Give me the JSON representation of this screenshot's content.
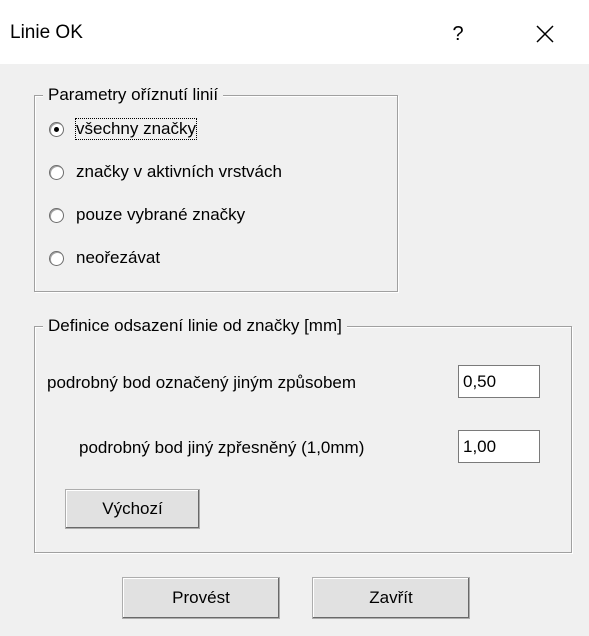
{
  "window": {
    "title": "Linie OK",
    "help_label": "?",
    "close_icon": "close-icon"
  },
  "clip_group": {
    "legend": "Parametry oříznutí linií",
    "options": [
      {
        "label": "všechny značky",
        "checked": true
      },
      {
        "label": "značky v aktivních vrstvách",
        "checked": false
      },
      {
        "label": "pouze vybrané značky",
        "checked": false
      },
      {
        "label": "neořezávat",
        "checked": false
      }
    ]
  },
  "offset_group": {
    "legend": "Definice odsazení linie od značky [mm]",
    "fields": [
      {
        "label": "podrobný bod označený jiným způsobem",
        "value": "0,50"
      },
      {
        "label": "podrobný bod jiný zpřesněný (1,0mm)",
        "value": "1,00"
      }
    ],
    "default_button": "Výchozí"
  },
  "footer": {
    "execute_button": "Provést",
    "close_button": "Zavřít"
  }
}
